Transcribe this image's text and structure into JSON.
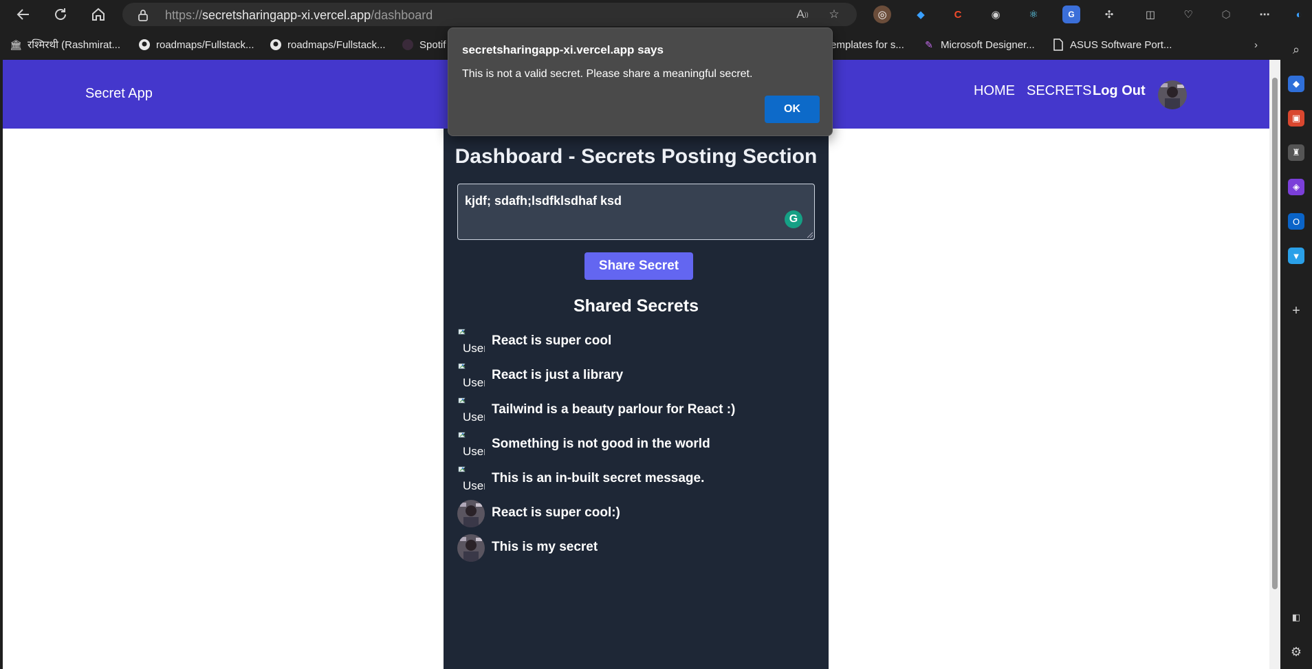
{
  "browser": {
    "url_scheme": "https://",
    "url_host": "secretsharingapp-xi.vercel.app",
    "url_path": "/dashboard",
    "bookmarks": [
      {
        "label": "रश्मिरथी (Rashmirat..."
      },
      {
        "label": "roadmaps/Fullstack..."
      },
      {
        "label": "roadmaps/Fullstack..."
      },
      {
        "label": "Spotif"
      },
      {
        "label": "templates for s..."
      },
      {
        "label": "Microsoft Designer..."
      },
      {
        "label": "ASUS Software Port..."
      }
    ]
  },
  "navbar": {
    "brand": "Secret App",
    "links": {
      "home": "HOME",
      "secrets": "SECRETS",
      "logout": "Log Out"
    }
  },
  "dashboard": {
    "title": "Dashboard - Secrets Posting Section",
    "textarea_value": "kjdf; sdafh;lsdfklsdhaf ksd",
    "share_button": "Share Secret",
    "shared_title": "Shared Secrets",
    "broken_alt": "User",
    "secrets": [
      {
        "text": "React is super cool",
        "avatar": "broken"
      },
      {
        "text": "React is just a library",
        "avatar": "broken"
      },
      {
        "text": "Tailwind is a beauty parlour for React :)",
        "avatar": "broken"
      },
      {
        "text": "Something is not good in the world",
        "avatar": "broken"
      },
      {
        "text": "This is an in-built secret message.",
        "avatar": "broken"
      },
      {
        "text": "React is super cool:)",
        "avatar": "photo"
      },
      {
        "text": "This is my secret",
        "avatar": "photo"
      }
    ]
  },
  "alert": {
    "title": "secretsharingapp-xi.vercel.app says",
    "message": "This is not a valid secret. Please share a meaningful secret.",
    "ok": "OK"
  },
  "colors": {
    "navbar": "#4437cc",
    "panel": "#1e2736",
    "share_button": "#6366f1",
    "alert_ok": "#0d6ac9"
  }
}
